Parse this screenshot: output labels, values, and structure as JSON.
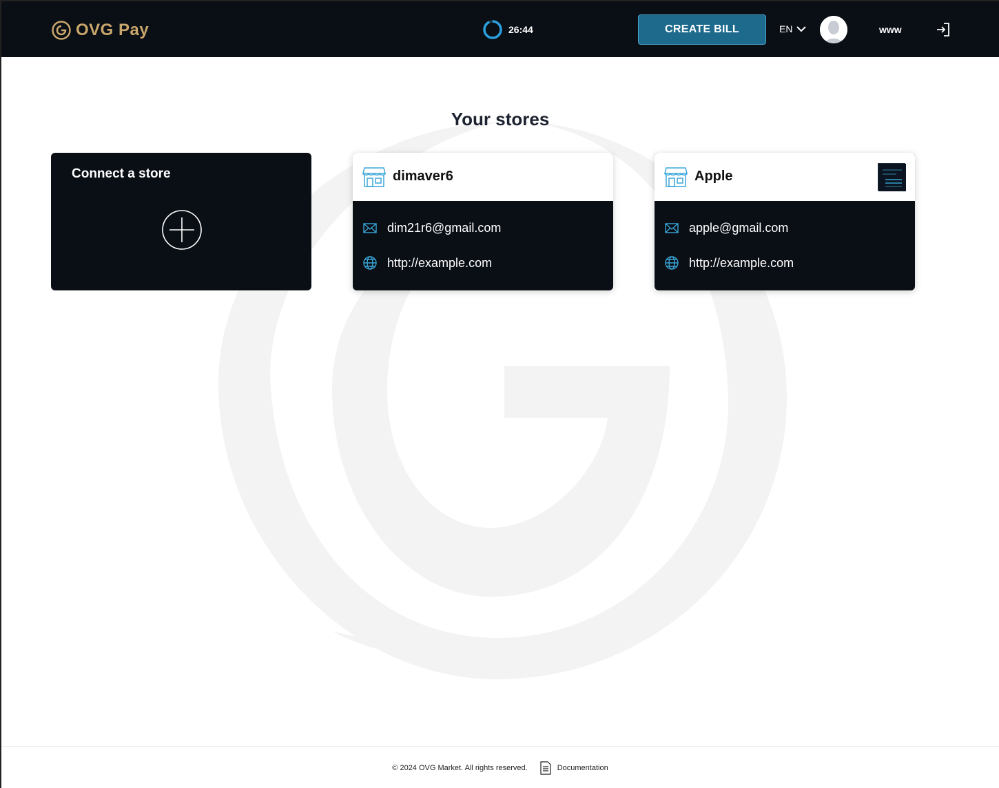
{
  "header": {
    "logo_text": "OVG Pay",
    "timer": "26:44",
    "create_bill_label": "CREATE BILL",
    "language": "EN",
    "username": "www"
  },
  "main": {
    "title": "Your stores",
    "connect_card": {
      "title": "Connect a store"
    },
    "stores": [
      {
        "name": "dimaver6",
        "email": "dim21r6@gmail.com",
        "website": "http://example.com"
      },
      {
        "name": "Apple",
        "email": "apple@gmail.com",
        "website": "http://example.com"
      }
    ]
  },
  "footer": {
    "copyright": "© 2024 OVG Market. All rights reserved.",
    "documentation_label": "Documentation"
  },
  "colors": {
    "header_bg": "#0a0e15",
    "accent": "#1d6a8c",
    "brand_gold": "#c9a66b",
    "icon_blue": "#3aa6d8"
  },
  "icons": [
    "ovg-logo-icon",
    "timer-ring-icon",
    "chevron-down-icon",
    "avatar-icon",
    "logout-icon",
    "plus-circle-icon",
    "store-icon",
    "mail-icon",
    "globe-icon",
    "document-icon"
  ]
}
